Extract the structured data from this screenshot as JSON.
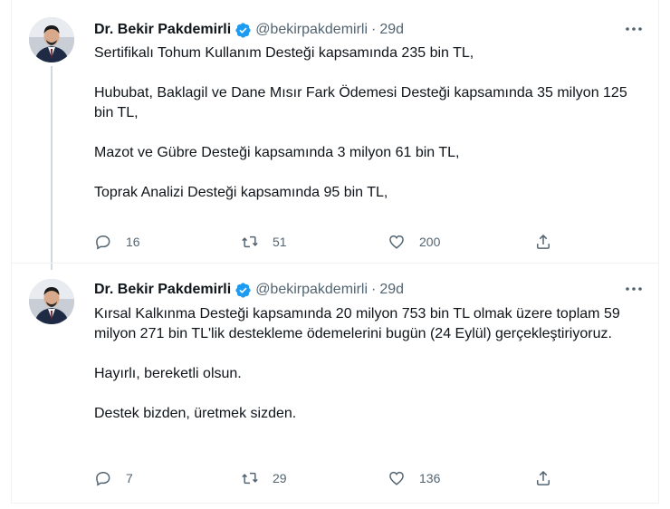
{
  "tweets": [
    {
      "author": {
        "name": "Dr. Bekir Pakdemirli",
        "handle": "@bekirpakdemirli",
        "time": "29d"
      },
      "paragraphs": [
        "Sertifikalı Tohum Kullanım Desteği kapsamında 235 bin TL,",
        "Hububat, Baklagil ve Dane Mısır Fark Ödemesi Desteği kapsamında 35 milyon 125 bin TL,",
        "Mazot ve Gübre Desteği kapsamında 3 milyon 61 bin TL,",
        "Toprak Analizi Desteği kapsamında 95 bin TL,"
      ],
      "stats": {
        "replies": "16",
        "retweets": "51",
        "likes": "200"
      }
    },
    {
      "author": {
        "name": "Dr. Bekir Pakdemirli",
        "handle": "@bekirpakdemirli",
        "time": "29d"
      },
      "paragraphs": [
        "Kırsal Kalkınma Desteği kapsamında 20 milyon 753 bin TL olmak üzere toplam 59 milyon 271 bin TL'lik destekleme ödemelerini bugün (24 Eylül) gerçekleştiriyoruz.",
        "Hayırlı, bereketli olsun.",
        "Destek bizden, üretmek sizden."
      ],
      "stats": {
        "replies": "7",
        "retweets": "29",
        "likes": "136"
      }
    }
  ],
  "icons": {
    "verified": "verified-badge-icon",
    "more": "more-dots-icon",
    "reply": "reply-bubble-icon",
    "retweet": "retweet-icon",
    "like": "heart-icon",
    "share": "share-upload-icon"
  },
  "colors": {
    "verified": "#1d9bf0",
    "muted": "#536471",
    "text": "#0f1419",
    "line": "#cfd9de"
  }
}
